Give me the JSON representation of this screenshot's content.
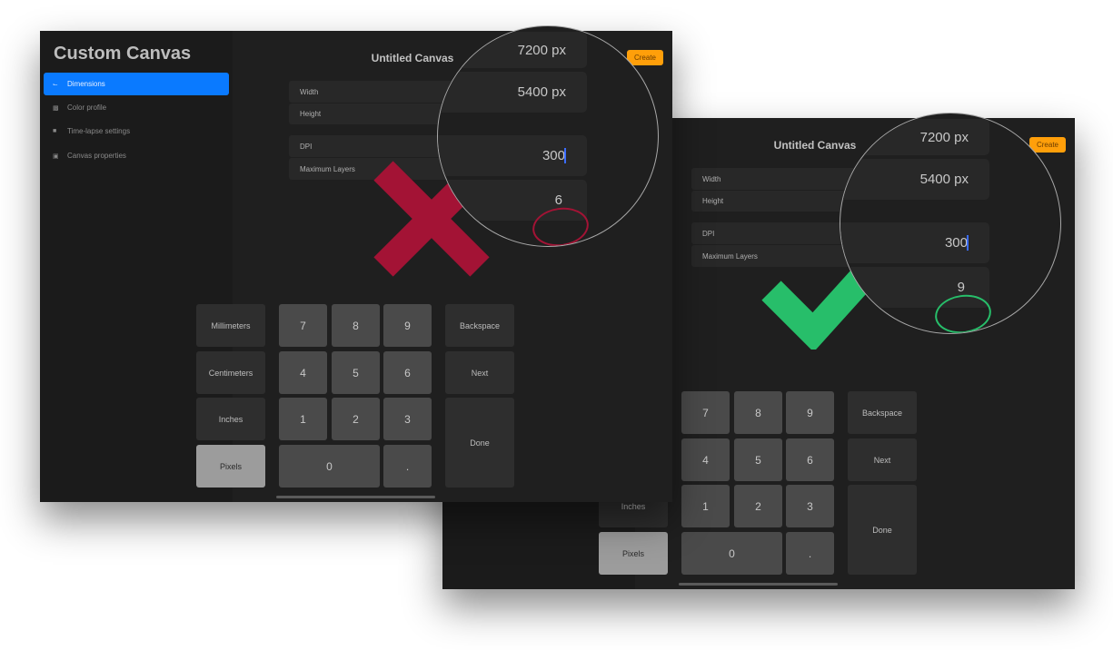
{
  "screens": [
    {
      "id": "correct",
      "app_title": "Custom Canvas",
      "sidebar": [
        {
          "label": "Dimensions",
          "icon": "dimensions-icon",
          "active": true
        },
        {
          "label": "Color profile",
          "icon": "color-profile-icon"
        },
        {
          "label": "Time-lapse settings",
          "icon": "video-camera-icon"
        },
        {
          "label": "Canvas properties",
          "icon": "canvas-properties-icon"
        }
      ],
      "doc_title": "Untitled Canvas",
      "create_label": "Create",
      "fields": {
        "width_label": "Width",
        "height_label": "Height",
        "dpi_label": "DPI",
        "layers_label": "Maximum Layers"
      },
      "magnified": {
        "width": "7200 px",
        "height": "5400 px",
        "dpi": "300",
        "layers": "9"
      },
      "keypad": {
        "units": [
          "Millimeters",
          "Centimeters",
          "Inches",
          "Pixels"
        ],
        "selected_unit": "Pixels",
        "digits": [
          "7",
          "8",
          "9",
          "4",
          "5",
          "6",
          "1",
          "2",
          "3",
          "0",
          "."
        ],
        "actions": [
          "Backspace",
          "Next",
          "Done"
        ]
      },
      "verdict": "check",
      "verdict_color": "#27be6a"
    },
    {
      "id": "incorrect",
      "app_title": "Custom Canvas",
      "sidebar": [
        {
          "label": "Dimensions",
          "icon": "dimensions-icon",
          "active": true
        },
        {
          "label": "Color profile",
          "icon": "color-profile-icon"
        },
        {
          "label": "Time-lapse settings",
          "icon": "video-camera-icon"
        },
        {
          "label": "Canvas properties",
          "icon": "canvas-properties-icon"
        }
      ],
      "doc_title": "Untitled Canvas",
      "create_label": "Create",
      "fields": {
        "width_label": "Width",
        "height_label": "Height",
        "dpi_label": "DPI",
        "layers_label": "Maximum Layers"
      },
      "magnified": {
        "width": "7200 px",
        "height": "5400 px",
        "dpi": "300",
        "layers": "6"
      },
      "keypad": {
        "units": [
          "Millimeters",
          "Centimeters",
          "Inches",
          "Pixels"
        ],
        "selected_unit": "Pixels",
        "digits": [
          "7",
          "8",
          "9",
          "4",
          "5",
          "6",
          "1",
          "2",
          "3",
          "0",
          "."
        ],
        "actions": [
          "Backspace",
          "Next",
          "Done"
        ]
      },
      "verdict": "cross",
      "verdict_color": "#a31335"
    }
  ],
  "colors": {
    "accent": "#0a7aff",
    "create": "#ff9f0a",
    "cursor": "#3b6cff"
  }
}
